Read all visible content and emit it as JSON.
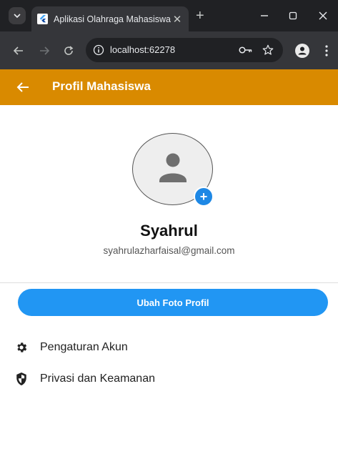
{
  "browser": {
    "tab_title": "Aplikasi Olahraga Mahasiswa",
    "url": "localhost:62278",
    "icons": [
      "tab-search-icon",
      "flutter-icon",
      "close-icon",
      "new-tab-icon",
      "minimize-icon",
      "maximize-icon",
      "window-close-icon",
      "back-icon",
      "forward-icon",
      "reload-icon",
      "site-info-icon",
      "password-key-icon",
      "bookmark-star-icon",
      "profile-icon",
      "menu-icon"
    ]
  },
  "appbar": {
    "title": "Profil Mahasiswa",
    "color": "#d98a00"
  },
  "profile": {
    "name": "Syahrul",
    "email": "syahrulazharfaisal@gmail.com"
  },
  "actions": {
    "change_photo_label": "Ubah Foto Profil",
    "button_color": "#2196f3"
  },
  "menu": {
    "items": [
      {
        "label": "Pengaturan Akun",
        "icon": "gear-icon"
      },
      {
        "label": "Privasi dan Keamanan",
        "icon": "shield-icon"
      }
    ]
  }
}
